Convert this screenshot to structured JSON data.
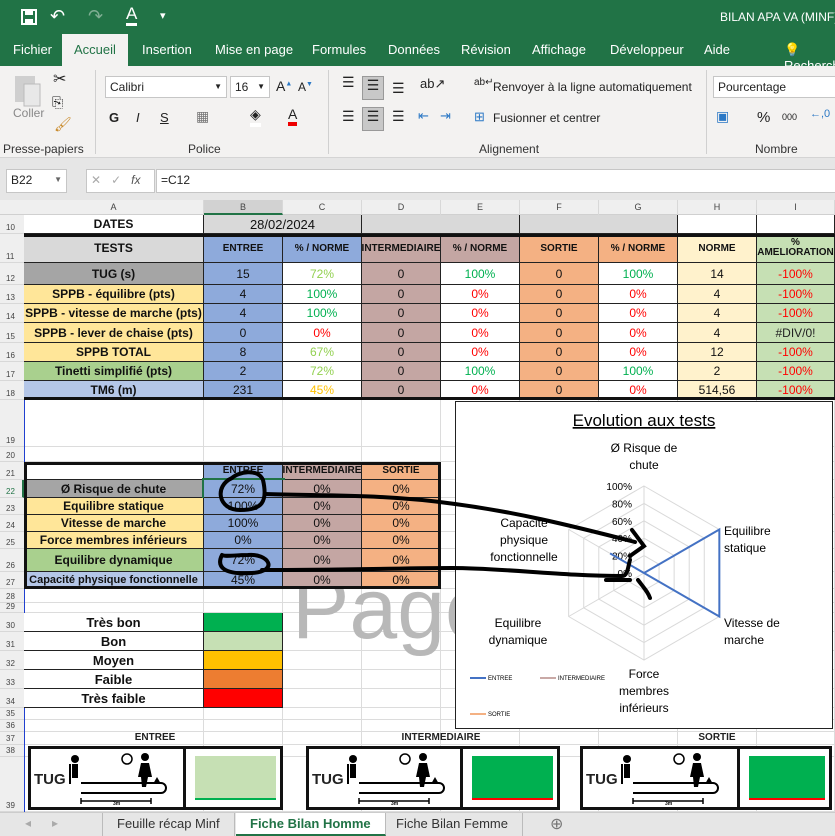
{
  "window": {
    "title": "BILAN APA VA (MINF)"
  },
  "ribbon": {
    "tabs": [
      "Fichier",
      "Accueil",
      "Insertion",
      "Mise en page",
      "Formules",
      "Données",
      "Révision",
      "Affichage",
      "Développeur",
      "Aide",
      "Recherche"
    ],
    "active_tab": "Accueil",
    "paste_label": "Coller",
    "font_name": "Calibri",
    "font_size": "16",
    "bold": "G",
    "italic": "I",
    "underline": "S",
    "wrap_label": "Renvoyer à la ligne automatiquement",
    "merge_label": "Fusionner et centrer",
    "number_format": "Pourcentage",
    "percent": "%",
    "thousands": "000",
    "groups": [
      "Presse-papiers",
      "Police",
      "Alignement",
      "Nombre"
    ]
  },
  "formula_bar": {
    "name_box": "B22",
    "formula": "=C12",
    "fx": "fx"
  },
  "columns": [
    "A",
    "B",
    "C",
    "D",
    "E",
    "F",
    "G",
    "H",
    "I"
  ],
  "main_table": {
    "dates_label": "DATES",
    "date": "28/02/2024",
    "headers": [
      "TESTS",
      "ENTREE",
      "% / NORME",
      "INTERMEDIAIRE",
      "% / NORME",
      "SORTIE",
      "% / NORME",
      "NORME",
      "% AMELIORATION"
    ],
    "rows": [
      {
        "row": "12",
        "test": "TUG (s)",
        "entree": "15",
        "entree_pct": "72%",
        "inter": "0",
        "inter_pct": "100%",
        "sortie": "0",
        "sortie_pct": "100%",
        "norme": "14",
        "amelio": "-100%"
      },
      {
        "row": "13",
        "test": "SPPB - équilibre (pts)",
        "entree": "4",
        "entree_pct": "100%",
        "inter": "0",
        "inter_pct": "0%",
        "sortie": "0",
        "sortie_pct": "0%",
        "norme": "4",
        "amelio": "-100%"
      },
      {
        "row": "14",
        "test": "SPPB - vitesse de marche (pts)",
        "entree": "4",
        "entree_pct": "100%",
        "inter": "0",
        "inter_pct": "0%",
        "sortie": "0",
        "sortie_pct": "0%",
        "norme": "4",
        "amelio": "-100%"
      },
      {
        "row": "15",
        "test": "SPPB - lever de chaise (pts)",
        "entree": "0",
        "entree_pct": "0%",
        "inter": "0",
        "inter_pct": "0%",
        "sortie": "0",
        "sortie_pct": "0%",
        "norme": "4",
        "amelio": "#DIV/0!"
      },
      {
        "row": "16",
        "test": "SPPB TOTAL",
        "entree": "8",
        "entree_pct": "67%",
        "inter": "0",
        "inter_pct": "0%",
        "sortie": "0",
        "sortie_pct": "0%",
        "norme": "12",
        "amelio": "-100%"
      },
      {
        "row": "17",
        "test": "Tinetti simplifié (pts)",
        "entree": "2",
        "entree_pct": "72%",
        "inter": "0",
        "inter_pct": "100%",
        "sortie": "0",
        "sortie_pct": "100%",
        "norme": "2",
        "amelio": "-100%"
      },
      {
        "row": "18",
        "test": "TM6 (m)",
        "entree": "231",
        "entree_pct": "45%",
        "inter": "0",
        "inter_pct": "0%",
        "sortie": "0",
        "sortie_pct": "0%",
        "norme": "514,56",
        "amelio": "-100%"
      }
    ]
  },
  "summary_table": {
    "headers": [
      "ENTREE",
      "INTERMEDIAIRE",
      "SORTIE"
    ],
    "rows": [
      {
        "label": "Ø Risque de chute",
        "entree": "72%",
        "inter": "0%",
        "sortie": "0%"
      },
      {
        "label": "Equilibre statique",
        "entree": "100%",
        "inter": "0%",
        "sortie": "0%"
      },
      {
        "label": "Vitesse de marche",
        "entree": "100%",
        "inter": "0%",
        "sortie": "0%"
      },
      {
        "label": "Force membres inférieurs",
        "entree": "0%",
        "inter": "0%",
        "sortie": "0%"
      },
      {
        "label": "Equilibre dynamique",
        "entree": "72%",
        "inter": "0%",
        "sortie": "0%"
      },
      {
        "label": "Capacité physique fonctionnelle",
        "entree": "45%",
        "inter": "0%",
        "sortie": "0%"
      }
    ]
  },
  "legend_table": [
    {
      "label": "Très bon",
      "color": "#00b050"
    },
    {
      "label": "Bon",
      "color": "#c6e0b4"
    },
    {
      "label": "Moyen",
      "color": "#ffc000"
    },
    {
      "label": "Faible",
      "color": "#ed7d31"
    },
    {
      "label": "Très faible",
      "color": "#ff0000"
    }
  ],
  "watermark": "Page",
  "tug_panels": [
    {
      "title": "ENTREE",
      "label": "TUG",
      "distance": "3m",
      "result_color": "#c6e0b4"
    },
    {
      "title": "INTERMEDIAIRE",
      "label": "TUG",
      "distance": "3m",
      "result_color": "#00b050"
    },
    {
      "title": "SORTIE",
      "label": "TUG",
      "distance": "3m",
      "result_color": "#00b050"
    }
  ],
  "chart_data": {
    "type": "radar",
    "title": "Evolution aux tests",
    "categories": [
      "Ø Risque de chute",
      "Equilibre statique",
      "Vitesse de marche",
      "Force membres inférieurs",
      "Equilibre dynamique",
      "Capacité physique fonctionnelle"
    ],
    "ticks": [
      "0%",
      "20%",
      "40%",
      "60%",
      "80%",
      "100%"
    ],
    "range": [
      0,
      100
    ],
    "series": [
      {
        "name": "ENTREE",
        "color": "#4472c4",
        "values": [
          0,
          100,
          100,
          0,
          0,
          45
        ]
      },
      {
        "name": "INTERMEDIAIRE",
        "color": "#c9a9a6",
        "values": [
          0,
          0,
          0,
          0,
          0,
          0
        ]
      },
      {
        "name": "SORTIE",
        "color": "#f4b183",
        "values": [
          0,
          0,
          0,
          0,
          0,
          0
        ]
      }
    ],
    "legend": "bottom-left"
  },
  "sheet_tabs": [
    "Feuille récap Minf",
    "Fiche Bilan Homme",
    "Fiche Bilan Femme"
  ],
  "active_sheet": "Fiche Bilan Homme"
}
